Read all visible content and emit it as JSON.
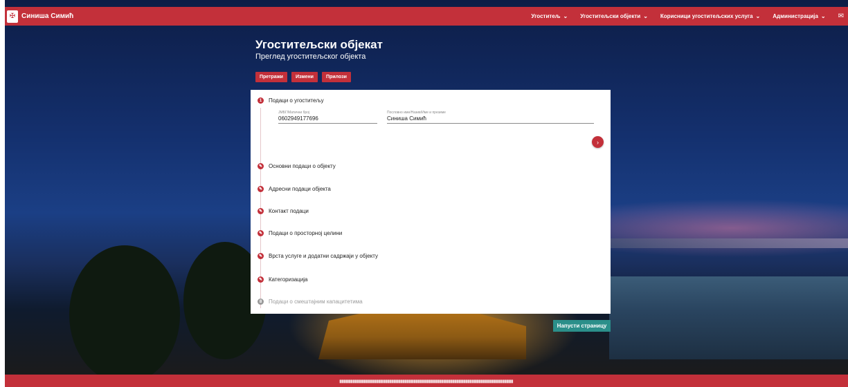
{
  "brand": {
    "name": "Синиша Симић"
  },
  "nav": {
    "items": [
      {
        "label": "Угоститељ"
      },
      {
        "label": "Угоститељски објекти"
      },
      {
        "label": "Корисници угоститељских услуга"
      },
      {
        "label": "Администрација"
      }
    ]
  },
  "header": {
    "title": "Угоститељски објекат",
    "subtitle": "Преглед угоститељског објекта"
  },
  "actions": [
    {
      "label": "Претражи"
    },
    {
      "label": "Измени"
    },
    {
      "label": "Прилози"
    }
  ],
  "steps": [
    {
      "label": "Подаци о угоститељу",
      "badge": "1"
    },
    {
      "label": "Основни подаци о објекту",
      "badge": "✎"
    },
    {
      "label": "Адресни подаци објекта",
      "badge": "✎"
    },
    {
      "label": "Контакт подаци",
      "badge": "✎"
    },
    {
      "label": "Подаци о просторној целини",
      "badge": "✎"
    },
    {
      "label": "Врста услуге и додатни садржаји у објекту",
      "badge": "✎"
    },
    {
      "label": "Категоризација",
      "badge": "✎"
    },
    {
      "label": "Подаци о смештајним капацитетима",
      "badge": "8"
    }
  ],
  "fields": {
    "jmbg": {
      "label": "ЈМБГ/Матични број",
      "value": "0602949177696"
    },
    "name": {
      "label": "Пословно име/Назив/Име и презиме",
      "value": "Синиша Симић"
    }
  },
  "leave_button": "Напусти страницу",
  "colors": {
    "primary": "#c3303a",
    "teal": "#2b8f8a"
  }
}
